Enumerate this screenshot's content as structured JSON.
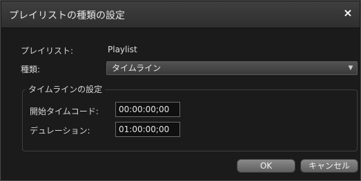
{
  "dialog": {
    "title": "プレイリストの種類の設定",
    "close_symbol": "×"
  },
  "playlist": {
    "label": "プレイリスト:",
    "value": "Playlist"
  },
  "type": {
    "label": "種類:",
    "selected": "タイムライン",
    "arrow": "▼"
  },
  "timeline_settings": {
    "group_title": "タイムラインの設定",
    "start_timecode_label": "開始タイムコード:",
    "start_timecode_value": "00:00:00;00",
    "duration_label": "デュレーション:",
    "duration_value": "01:00:00;00"
  },
  "buttons": {
    "ok": "OK",
    "cancel": "キャンセル"
  }
}
